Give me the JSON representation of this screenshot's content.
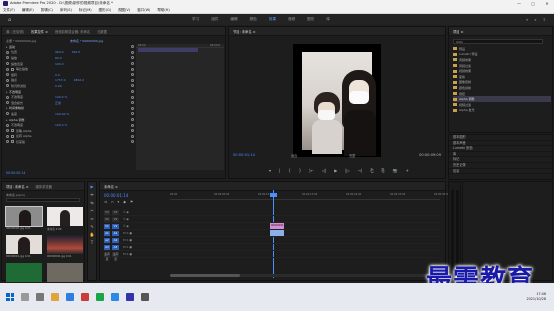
{
  "titlebar": {
    "title": "Adobe Premiere Pro 2020 - D:\\视频\\制作的视频项目\\未命名 *",
    "min": "—",
    "max": "▢",
    "close": "✕"
  },
  "menu": [
    "文件(F)",
    "编辑(E)",
    "剪辑(C)",
    "序列(S)",
    "标记(M)",
    "图形(G)",
    "视图(V)",
    "窗口(W)",
    "帮助(H)"
  ],
  "workspace": {
    "tabs": [
      "学习",
      "组件",
      "编辑",
      "颜色",
      "效果",
      "音频",
      "图形",
      "库"
    ],
    "active_index": 4,
    "more": "»"
  },
  "effect_controls": {
    "tabs": [
      "源: (无剪辑)",
      "效果控件 ≡",
      "音频剪辑混合器: 未命名",
      "元数据"
    ],
    "clip_label": "主要 * 00000000.jpg",
    "clip_label2": "未命名 * 00000000.jpg",
    "ruler_start": "00:00",
    "ruler_end": "00:00:0",
    "timecode": "00:00:00:14",
    "rows": [
      {
        "label": "运动",
        "value": "",
        "value2": "",
        "type": "section"
      },
      {
        "label": "位置",
        "value": "960.0",
        "value2": "540.0",
        "type": "param"
      },
      {
        "label": "缩放",
        "value": "60.0",
        "value2": "",
        "type": "param"
      },
      {
        "label": "缩放宽度",
        "value": "100.0",
        "value2": "",
        "type": "param"
      },
      {
        "label": "",
        "value": "等比缩放",
        "value2": "",
        "type": "check"
      },
      {
        "label": "旋转",
        "value": "0.0",
        "value2": "",
        "type": "param"
      },
      {
        "label": "锚点",
        "value": "1757.0",
        "value2": "1862.0",
        "type": "param"
      },
      {
        "label": "防闪烁滤镜",
        "value": "0.00",
        "value2": "",
        "type": "param"
      },
      {
        "label": "不透明度",
        "value": "",
        "value2": "",
        "type": "section"
      },
      {
        "label": "不透明度",
        "value": "100.0 %",
        "value2": "",
        "type": "param"
      },
      {
        "label": "混合模式",
        "value": "正常",
        "value2": "",
        "type": "param"
      },
      {
        "label": "时间重映射",
        "value": "",
        "value2": "",
        "type": "section"
      },
      {
        "label": "速度",
        "value": "100.00 %",
        "value2": "",
        "type": "param"
      },
      {
        "label": "Alpha 调整",
        "value": "",
        "value2": "",
        "type": "section"
      },
      {
        "label": "不透明度",
        "value": "100.0 %",
        "value2": "",
        "type": "param"
      },
      {
        "label": "",
        "value": "忽略 Alpha",
        "value2": "",
        "type": "check"
      },
      {
        "label": "",
        "value": "反转 Alpha",
        "value2": "",
        "type": "check"
      },
      {
        "label": "",
        "value": "仅蒙版",
        "value2": "",
        "type": "check"
      }
    ]
  },
  "program_monitor": {
    "tabs": [
      "节目: 未命名 ≡"
    ],
    "timecode": "00:00:01:14",
    "fit": "适合",
    "quality": "完整",
    "duration": "00:00:09:09",
    "controls": [
      "▾",
      "|",
      "{",
      "}",
      "|←",
      "◁|",
      "▶",
      "|▷",
      "→|",
      "⎗",
      "⎘",
      "📷",
      "+"
    ]
  },
  "project": {
    "tabs": [
      "项目 ≡"
    ],
    "search_value": "mlm",
    "items": [
      {
        "label": "预设",
        "selected": false
      },
      {
        "label": "Lumetri 预设",
        "selected": false
      },
      {
        "label": "音频效果",
        "selected": false
      },
      {
        "label": "音频过渡",
        "selected": false
      },
      {
        "label": "视频效果",
        "selected": false
      },
      {
        "label": "变换",
        "selected": false
      },
      {
        "label": "图像控制",
        "selected": false
      },
      {
        "label": "颜色替换",
        "selected": false
      },
      {
        "label": "键控",
        "selected": false
      },
      {
        "label": "Alpha 调整",
        "selected": true
      },
      {
        "label": "视频过渡",
        "selected": false
      },
      {
        "label": "Alpha 发光",
        "selected": false
      }
    ]
  },
  "right_panels": [
    "基本图形",
    "基本声音",
    "Lumetri 颜色",
    "库",
    "标记",
    "历史记录",
    "信息"
  ],
  "project_bottom": {
    "tabs": [
      "项目: 未命名 ≡",
      "媒体浏览器"
    ],
    "subtitle": "未命名.prproj",
    "thumbs": [
      {
        "caption": "00000000.jpg 4:01",
        "style": "a",
        "selected": true
      },
      {
        "caption": "未命名 5:00",
        "style": "b",
        "selected": false
      },
      {
        "caption": "00000001.jpg 4:01",
        "style": "c",
        "selected": false
      },
      {
        "caption": "00000002.jpg 4:01",
        "style": "d",
        "selected": false
      },
      {
        "caption": "00000003.jpg 4:01",
        "style": "e",
        "selected": false
      },
      {
        "caption": "00000004.jpg 4:01",
        "style": "f",
        "selected": false
      }
    ]
  },
  "tools": [
    "▶",
    "⇹",
    "⇆",
    "✂",
    "⇔",
    "✎",
    "✋",
    "T"
  ],
  "timeline": {
    "tabs": [
      "未命名 ≡"
    ],
    "timecode": "00:00:01:14",
    "controls": [
      "⇉",
      "∩",
      "▾",
      "◆",
      "⚑"
    ],
    "ruler": [
      "00:00",
      "00:00:05:00",
      "00:00:10:00",
      "00:00:15:00",
      "00:00:20:00",
      "00:00:25:00",
      "00:00:30:00"
    ],
    "tracks": [
      {
        "name": "V3",
        "target": false,
        "clip": ""
      },
      {
        "name": "V2",
        "target": false,
        "clip": ""
      },
      {
        "name": "V1",
        "target": true,
        "clip": "00000000.jpg"
      },
      {
        "name": "A1",
        "target": true,
        "clip": "audio"
      },
      {
        "name": "A2",
        "target": true,
        "clip": ""
      },
      {
        "name": "A3",
        "target": true,
        "clip": ""
      },
      {
        "name": "主声道",
        "target": false,
        "clip": ""
      }
    ]
  },
  "watermark": "最需教育",
  "taskbar": {
    "time": "17:46",
    "date": "2021/10/28"
  }
}
